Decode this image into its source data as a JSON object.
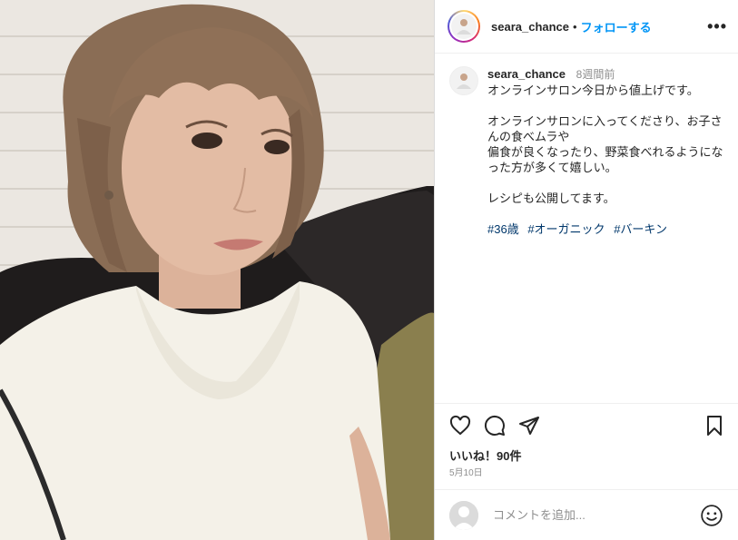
{
  "post": {
    "username": "seara_chance",
    "separator": "•",
    "follow_label": "フォローする",
    "more_icon": "•••",
    "photo_alt": "selfie-photo"
  },
  "caption": {
    "username": "seara_chance",
    "time": "8週間前",
    "lines": [
      "オンラインサロン今日から値上げです。",
      "",
      "オンラインサロンに入ってくださり、お子さんの食べムラや",
      "偏食が良くなったり、野菜食べれるようになった方が多くて嬉しい。",
      "",
      "レシピも公開してます。",
      ""
    ],
    "hashtags": [
      "#36歳",
      "#オーガニック",
      "#バーキン"
    ]
  },
  "actions": {
    "like_icon": "heart-icon",
    "comment_icon": "comment-icon",
    "share_icon": "share-icon",
    "save_icon": "bookmark-icon"
  },
  "likes": "いいね！90件",
  "date": "5月10日",
  "comment": {
    "placeholder": "コメントを追加...",
    "emoji_icon": "emoji-icon"
  }
}
